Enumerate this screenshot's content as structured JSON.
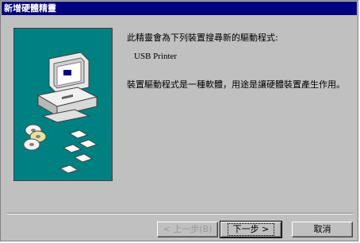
{
  "window": {
    "title": "新增硬體精靈"
  },
  "content": {
    "intro": "此精靈會為下列裝置搜尋新的驅動程式:",
    "devices": [
      "USB Printer"
    ],
    "description": "裝置驅動程式是一種軟體，用途是讓硬體裝置產生作用。"
  },
  "buttons": {
    "back": "< 上一步(B)",
    "next": "下一步 >",
    "cancel": "取消"
  },
  "colors": {
    "titlebar": "#000080",
    "panel": "#008080",
    "face": "#c0c0c0"
  },
  "illustration": {
    "icons": [
      "computer-icon",
      "cd-discs-icon",
      "floppy-disks-icon"
    ]
  }
}
